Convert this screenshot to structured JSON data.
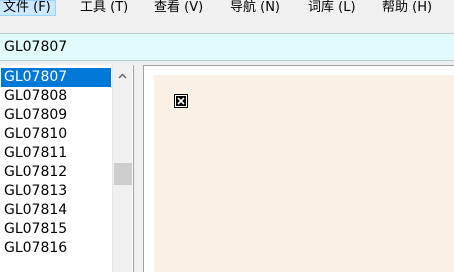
{
  "menu": {
    "items": [
      {
        "label": "文件 (F)"
      },
      {
        "label": "工具 (T)"
      },
      {
        "label": "查看 (V)"
      },
      {
        "label": "导航 (N)"
      },
      {
        "label": "词库 (L)"
      },
      {
        "label": "帮助 (H)"
      }
    ]
  },
  "search": {
    "value": "GL07807"
  },
  "word_list": {
    "items": [
      "GL07807",
      "GL07808",
      "GL07809",
      "GL07810",
      "GL07811",
      "GL07812",
      "GL07813",
      "GL07814",
      "GL07815",
      "GL07816"
    ],
    "selected": "GL07807"
  },
  "icons": {
    "scroll_up": "chevron-up-icon",
    "content_image": "broken-image-icon"
  },
  "colors": {
    "selection": "#0078d7",
    "search_bg": "#e1fafa",
    "content_bg": "#faf0e6",
    "menu_active": "#cce8ff"
  }
}
